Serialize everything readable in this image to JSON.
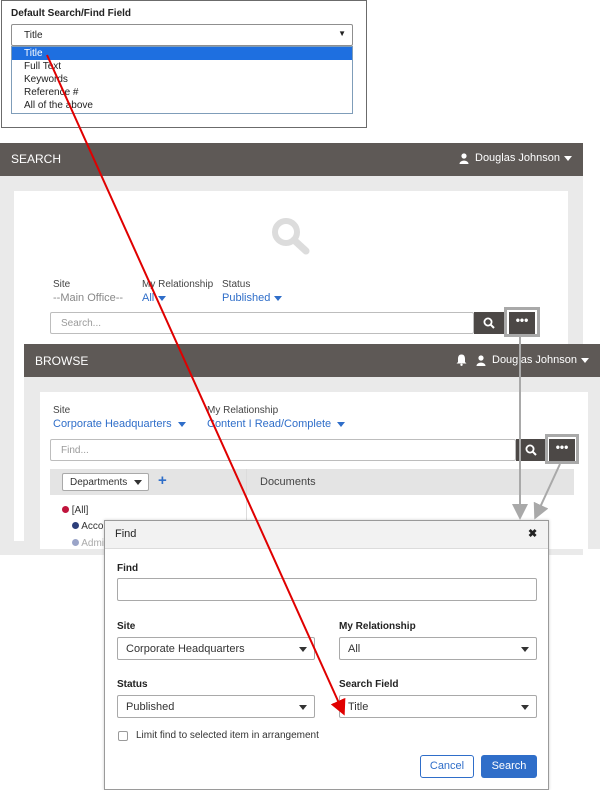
{
  "dropdown": {
    "title": "Default Search/Find Field",
    "selected": "Title",
    "options": [
      "Title",
      "Full Text",
      "Keywords",
      "Reference #",
      "All of the above"
    ]
  },
  "search": {
    "title": "SEARCH",
    "user": "Douglas Johnson",
    "site_label": "Site",
    "site_value": "--Main Office--",
    "relationship_label": "My Relationship",
    "relationship_value": "All",
    "status_label": "Status",
    "status_value": "Published",
    "placeholder": "Search...",
    "more_label": "•••"
  },
  "browse": {
    "title": "BROWSE",
    "user": "Douglas Johnson",
    "site_label": "Site",
    "site_value": "Corporate Headquarters",
    "relationship_label": "My Relationship",
    "relationship_value": "Content I Read/Complete",
    "placeholder": "Find...",
    "more_label": "•••",
    "departments_label": "Departments",
    "add_label": "+",
    "documents_label": "Documents",
    "tree": [
      "[All]",
      "Acco",
      "Admi"
    ]
  },
  "find": {
    "title": "Find",
    "close": "✖",
    "find_label": "Find",
    "site_label": "Site",
    "site_value": "Corporate Headquarters",
    "relationship_label": "My Relationship",
    "relationship_value": "All",
    "status_label": "Status",
    "status_value": "Published",
    "search_field_label": "Search Field",
    "search_field_value": "Title",
    "limit_label": "Limit find to selected item in arrangement",
    "cancel_label": "Cancel",
    "search_label": "Search"
  },
  "colors": {
    "header": "#5e5956",
    "accent": "#2f6ec9",
    "selection": "#1e6fe0",
    "annotation": "#e00000"
  }
}
